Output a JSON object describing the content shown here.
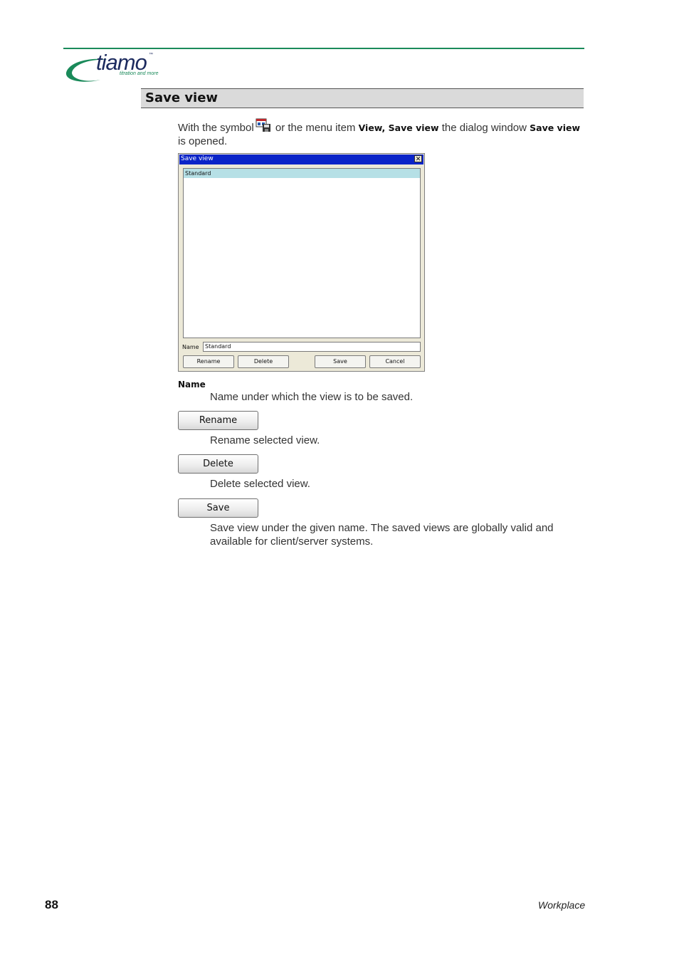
{
  "logo": {
    "word": "tiamo",
    "tm": "™",
    "tagline": "titration and more",
    "colors": {
      "green": "#1a8a5a",
      "navy": "#1c2a5e"
    }
  },
  "section": {
    "title": "Save view"
  },
  "intro": {
    "part1": "With the symbol",
    "symbol_icon": "save-view-icon",
    "part2": " or the menu item ",
    "menu_path": "View, Save view",
    "part3": " the dialog window ",
    "dialog_name": "Save view",
    "part4": "is opened."
  },
  "dialog": {
    "title": "Save view",
    "close_glyph": "✕",
    "list_items": [
      "Standard"
    ],
    "name_label": "Name",
    "name_value": "Standard",
    "buttons": {
      "rename": "Rename",
      "delete": "Delete",
      "save": "Save",
      "cancel": "Cancel"
    },
    "colors": {
      "titlebar": "#0a24c8",
      "selection": "#b6e0e6"
    }
  },
  "descriptions": {
    "name_term": "Name",
    "name_text": "Name under which the view is to be saved.",
    "rename_button": "Rename",
    "rename_text": "Rename selected view.",
    "delete_button": "Delete",
    "delete_text": "Delete selected view.",
    "save_button": "Save",
    "save_text_line1": "Save view under the given name. The saved views are globally valid and",
    "save_text_line2": "available for client/server systems."
  },
  "footer": {
    "page_number": "88",
    "chapter": "Workplace"
  }
}
